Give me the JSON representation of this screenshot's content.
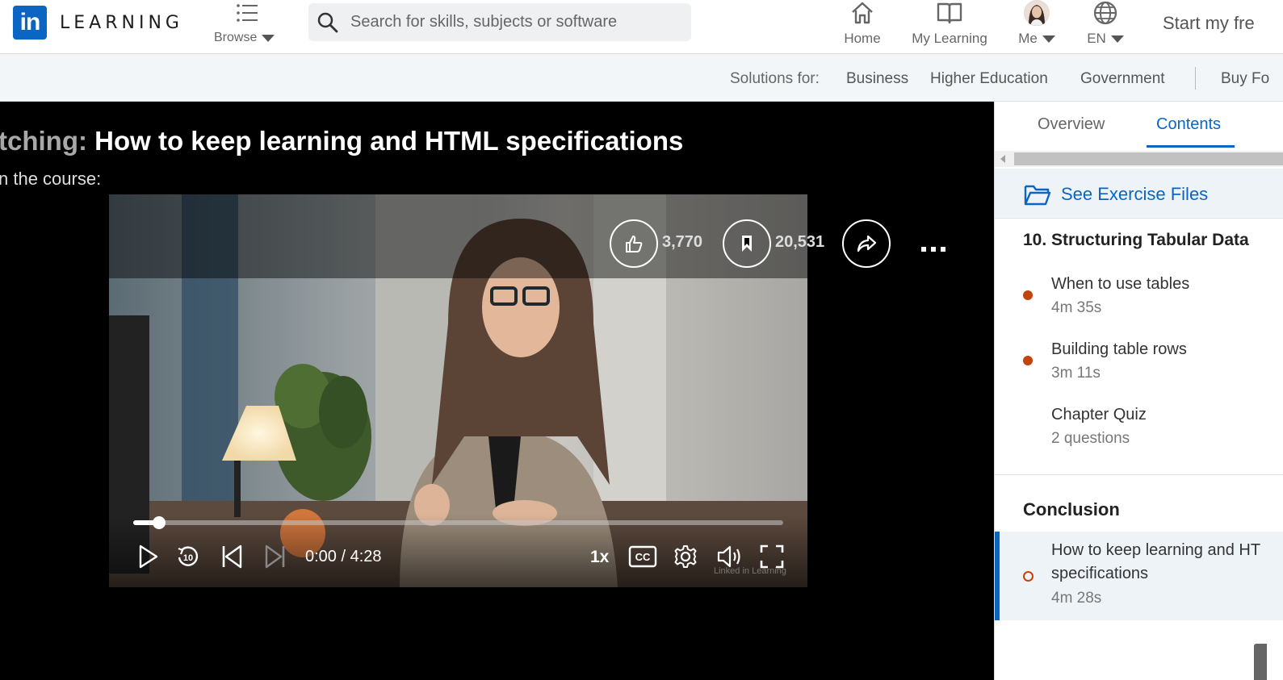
{
  "header": {
    "logo_mark": "in",
    "logo_text": "LEARNING",
    "browse_label": "Browse",
    "search_placeholder": "Search for skills, subjects or software",
    "nav": {
      "home": "Home",
      "my_learning": "My Learning",
      "me": "Me",
      "language": "EN"
    },
    "start_trial": "Start my fre"
  },
  "subnav": {
    "solutions_label": "Solutions for:",
    "links": [
      "Business",
      "Higher Education",
      "Government"
    ],
    "buy": "Buy Fo"
  },
  "player": {
    "watching_prefix": "tching:",
    "watching_title": "How to keep learning and HTML specifications",
    "in_course": "n the course:",
    "likes": "3,770",
    "saves": "20,531",
    "more": "…",
    "time": "0:00 / 4:28",
    "progress_fraction": 0.04,
    "speed": "1x",
    "watermark": "Linked in Learning"
  },
  "panel": {
    "tabs": [
      "Overview",
      "Contents"
    ],
    "active_tab": "Contents",
    "exercise_files": "See Exercise Files",
    "chapter_title": "10. Structuring Tabular Data",
    "lessons": [
      {
        "title": "When to use tables",
        "meta": "4m 35s",
        "status": "in-progress"
      },
      {
        "title": "Building table rows",
        "meta": "3m 11s",
        "status": "in-progress"
      },
      {
        "title": "Chapter Quiz",
        "meta": "2 questions",
        "status": "none"
      }
    ],
    "section_title": "Conclusion",
    "current_lesson": {
      "title_line1": "How to keep learning and HT",
      "title_line2": "specifications",
      "meta": "4m 28s"
    }
  },
  "colors": {
    "brand": "#0a66c2",
    "progress_dot": "#c4420c"
  }
}
